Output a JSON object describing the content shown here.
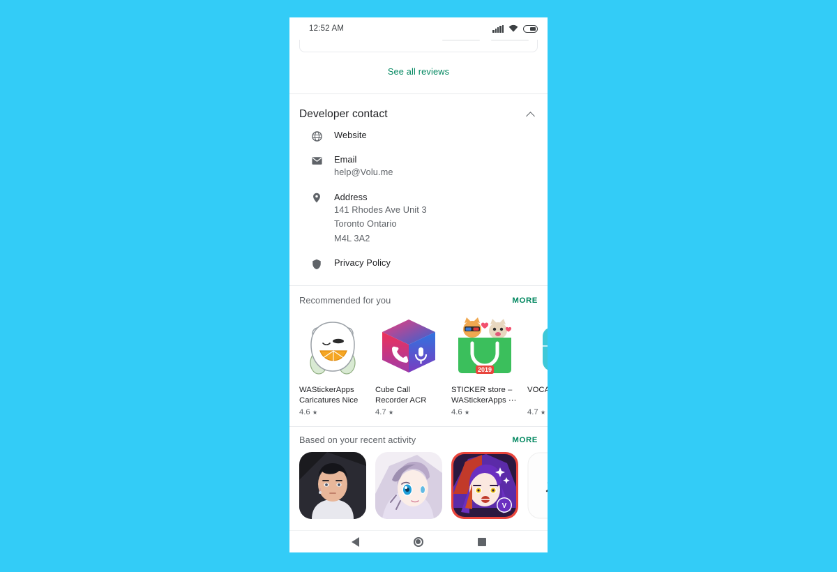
{
  "theme": {
    "page_background": "#33ccf7",
    "accent_green": "#01875f",
    "text_primary": "#202124",
    "text_secondary": "#5f6368"
  },
  "status_bar": {
    "time": "12:52 AM",
    "icons": [
      "signal-icon",
      "wifi-icon",
      "battery-icon"
    ]
  },
  "reviews": {
    "see_all_label": "See all reviews"
  },
  "developer_contact": {
    "title": "Developer contact",
    "toggle_icon": "chevron-up-icon",
    "rows": [
      {
        "icon": "globe-icon",
        "label": "Website",
        "values": []
      },
      {
        "icon": "email-icon",
        "label": "Email",
        "values": [
          "help@Volu.me"
        ]
      },
      {
        "icon": "pin-icon",
        "label": "Address",
        "values": [
          "141 Rhodes Ave Unit 3",
          "Toronto Ontario",
          "M4L 3A2"
        ]
      },
      {
        "icon": "shield-icon",
        "label": "Privacy Policy",
        "values": []
      }
    ]
  },
  "recommended": {
    "title": "Recommended for you",
    "more_label": "MORE",
    "apps": [
      {
        "icon": "white-bear-sticker-icon",
        "name": "WAStickerApps Caricatures Nice",
        "rating": "4.6"
      },
      {
        "icon": "cube-call-recorder-icon",
        "name": "Cube Call Recorder ACR",
        "rating": "4.7"
      },
      {
        "icon": "sticker-store-bag-icon",
        "name": "STICKER store – WAStickerApps ⋯",
        "rating": "4.6"
      },
      {
        "icon": "voca-sticker-icon",
        "name": "VOCA Sticke",
        "rating": "4.7"
      }
    ]
  },
  "recent_activity": {
    "title": "Based on your recent activity",
    "more_label": "MORE",
    "apps": [
      {
        "icon": "anime-boy-dark-icon"
      },
      {
        "icon": "anime-girl-blue-eye-icon"
      },
      {
        "icon": "anime-purple-hair-icon"
      },
      {
        "icon": "anime-partial-icon"
      }
    ]
  },
  "nav_bar": {
    "buttons": [
      "back-button",
      "home-button",
      "recents-button"
    ]
  }
}
